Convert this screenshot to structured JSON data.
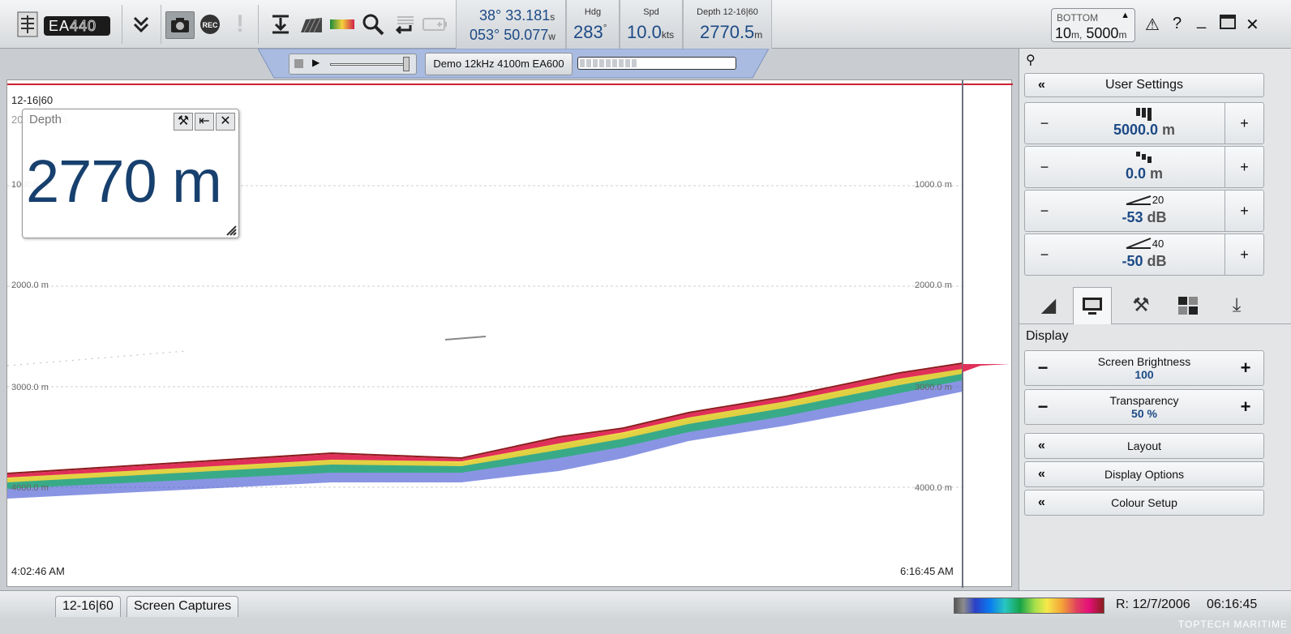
{
  "topbar": {
    "logo_text": "EA",
    "logo_number": "440",
    "rec_label": "REC",
    "lat": {
      "deg": "38° 33.181",
      "hemi": "s"
    },
    "lon": {
      "deg": "053° 50.077",
      "hemi": "w"
    },
    "hdg": {
      "label": "Hdg",
      "value": "283",
      "unit": "°"
    },
    "spd": {
      "label": "Spd",
      "value": "10.0",
      "unit": "kts"
    },
    "depth": {
      "label": "Depth 12-16|60",
      "value": "2770.5",
      "unit": "m"
    },
    "bottom": {
      "label": "BOTTOM",
      "min": "10",
      "min_unit": "m,",
      "max": "5000",
      "max_unit": "m"
    }
  },
  "replay": {
    "file_label": "Demo 12kHz 4100m EA600",
    "progress_fraction": 0.6
  },
  "echogram": {
    "channel": "12-16|60",
    "mode": "20 Log TVG",
    "start_time": "4:02:46 AM",
    "end_time": "6:16:45 AM",
    "depth_labels": [
      "1000.0 m",
      "2000.0 m",
      "3000.0 m",
      "4000.0 m"
    ]
  },
  "depth_window": {
    "title": "Depth",
    "value": "2770 m"
  },
  "settings": {
    "user_settings": "User Settings",
    "range": {
      "value": "5000.0",
      "unit": "m"
    },
    "start": {
      "value": "0.0",
      "unit": "m"
    },
    "tvg20": {
      "value": "-53",
      "unit": "dB",
      "tag": "20"
    },
    "tvg40": {
      "value": "-50",
      "unit": "dB",
      "tag": "40"
    },
    "section": "Display",
    "brightness": {
      "label": "Screen Brightness",
      "value": "100"
    },
    "transparency": {
      "label": "Transparency",
      "value": "50",
      "unit": "%"
    },
    "layout": "Layout",
    "display_options": "Display Options",
    "colour_setup": "Colour Setup"
  },
  "status": {
    "tab1": "12-16|60",
    "tab2": "Screen Captures",
    "record_info": "R: 12/7/2006",
    "time": "06:16:45",
    "watermark": "TOPTECH MARITIME"
  },
  "colors": {
    "accent": "#1c4a86",
    "bg": "#e3e5e7"
  }
}
